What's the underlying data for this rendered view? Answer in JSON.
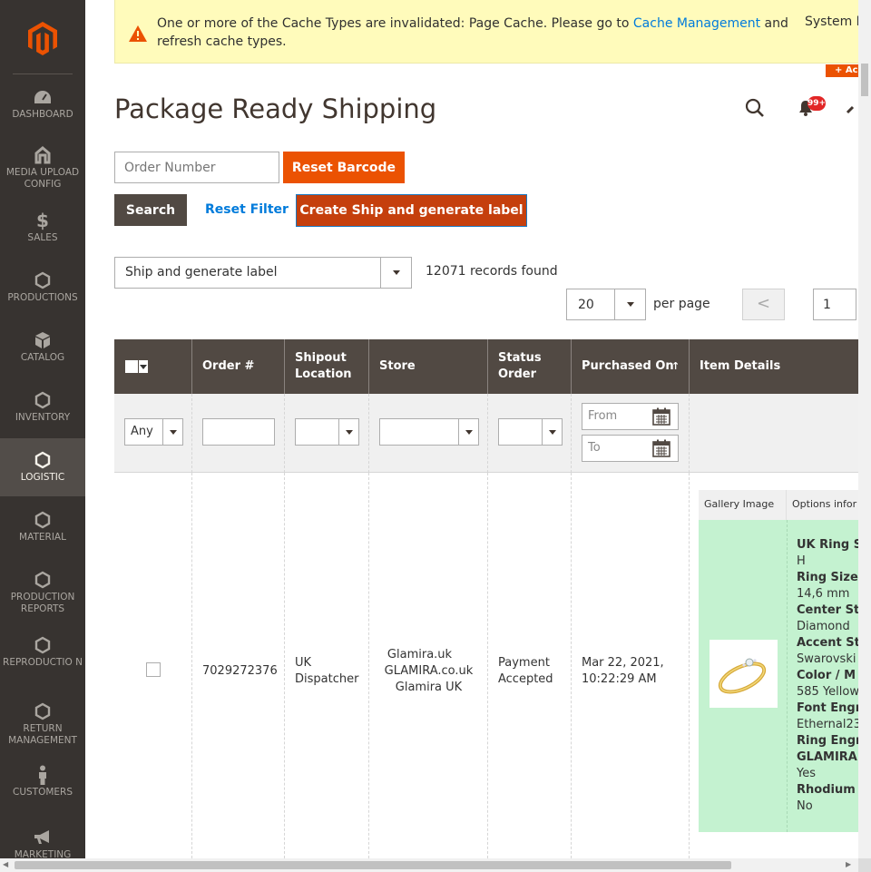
{
  "sidebar": {
    "items": [
      {
        "label": "DASHBOARD",
        "icon": "dashboard-icon"
      },
      {
        "label": "MEDIA UPLOAD CONFIG",
        "icon": "media-upload-icon"
      },
      {
        "label": "SALES",
        "icon": "dollar-icon"
      },
      {
        "label": "PRODUCTIONS",
        "icon": "hexagon-icon"
      },
      {
        "label": "CATALOG",
        "icon": "cube-icon"
      },
      {
        "label": "INVENTORY",
        "icon": "hexagon-icon"
      },
      {
        "label": "LOGISTIC",
        "icon": "hexagon-icon"
      },
      {
        "label": "MATERIAL",
        "icon": "hexagon-icon"
      },
      {
        "label": "PRODUCTION REPORTS",
        "icon": "hexagon-icon"
      },
      {
        "label": "REPRODUCTIO N",
        "icon": "hexagon-icon"
      },
      {
        "label": "RETURN MANAGEMENT",
        "icon": "hexagon-icon"
      },
      {
        "label": "CUSTOMERS",
        "icon": "person-icon"
      },
      {
        "label": "MARKETING",
        "icon": "megaphone-icon"
      }
    ],
    "active_index": 6
  },
  "notice": {
    "text_before": "One or more of the Cache Types are invalidated: Page Cache. Please go to ",
    "link": "Cache Management",
    "text_after": " and refresh cache types.",
    "system": "System M"
  },
  "header": {
    "add_badge": "+ Ac",
    "notification_count": "99+",
    "title": "Package Ready Shipping"
  },
  "toolbar": {
    "order_placeholder": "Order Number",
    "reset_barcode": "Reset Barcode",
    "search": "Search",
    "reset_filter": "Reset Filter",
    "create_ship": "Create Ship and generate label"
  },
  "massaction": {
    "selected": "Ship and generate label",
    "records": "12071 records found"
  },
  "pager": {
    "per_page_value": "20",
    "per_page_label": "per page",
    "prev": "<",
    "page": "1"
  },
  "grid": {
    "columns": [
      "Order #",
      "Shipout Location",
      "Store",
      "Status Order",
      "Purchased On",
      "Item Details"
    ],
    "sort_arrow": "↑",
    "filters": {
      "any": "Any",
      "from": "From",
      "to": "To"
    },
    "row": {
      "order": "7029272376",
      "location": "UK Dispatcher",
      "store": [
        "Glamira.uk",
        "GLAMIRA.co.uk",
        "Glamira UK"
      ],
      "status": "Payment Accepted",
      "purchased": "Mar 22, 2021, 10:22:29 AM",
      "details": {
        "gallery_header": "Gallery Image",
        "options_header": "Options infor",
        "options": [
          {
            "label": "UK Ring S",
            "value": "H"
          },
          {
            "label": "Ring Size",
            "value": "14,6 mm"
          },
          {
            "label": "Center St",
            "value": "Diamond"
          },
          {
            "label": "Accent St",
            "value": "Swarovski"
          },
          {
            "label": "Color / M",
            "value": "585 Yellow"
          },
          {
            "label": "Font Engr",
            "value": "Ethernal23"
          },
          {
            "label": "Ring Engr",
            "value": ""
          },
          {
            "label": "GLAMIRA",
            "value": "Yes"
          },
          {
            "label": "Rhodium",
            "value": "No"
          }
        ]
      }
    }
  },
  "colors": {
    "sidebar": "#373330",
    "accent": "#eb5202",
    "create_button": "#c53f0d",
    "grid_header": "#514943",
    "link": "#007bdb",
    "notice_bg": "#fffbbb",
    "details_bg": "#c4f2d0"
  }
}
